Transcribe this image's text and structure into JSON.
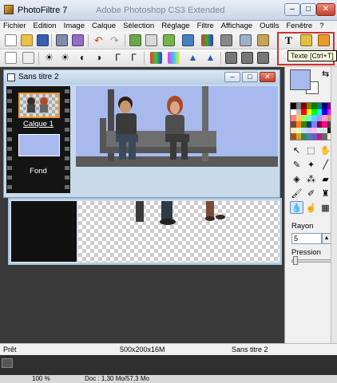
{
  "window": {
    "title": "PhotoFiltre 7",
    "background_title": "Adobe Photoshop CS3 Extended"
  },
  "window_controls": {
    "minimize": "–",
    "maximize": "□",
    "close": "✕"
  },
  "menu": [
    "Fichier",
    "Edition",
    "Image",
    "Calque",
    "Sélection",
    "Réglage",
    "Filtre",
    "Affichage",
    "Outils",
    "Fenêtre",
    "?"
  ],
  "tooltip": {
    "text": "Texte [Ctrl+T]"
  },
  "document": {
    "title": "Sans titre 2",
    "layers": [
      {
        "label": "Calque 1"
      },
      {
        "label": "Fond"
      }
    ]
  },
  "right_panel": {
    "rayon_label": "Rayon",
    "rayon_value": "5",
    "pression_label": "Pression"
  },
  "status": {
    "state": "Prêt",
    "size": "500x200x16M",
    "doc_name": "Sans titre 2"
  },
  "photoshop_status": {
    "zoom": "100 %",
    "doc_info": "Doc : 1,30 Mo/57,3 Mo"
  },
  "colors": {
    "foreground": "#a8b9ee",
    "background": "#ffffff",
    "highlight": "#d0302f",
    "selected_layer_border": "#f29a1f"
  },
  "icons": {
    "toolbar1": [
      "new-icon",
      "open-icon",
      "save-icon",
      "print-icon",
      "scan-icon",
      "undo-icon",
      "redo-icon",
      "copy-icon",
      "paste-icon",
      "image-size-icon",
      "canvas-icon",
      "fit-icon",
      "text-icon",
      "color-swap-icon",
      "crop-icon",
      "filter-icon"
    ],
    "toolbar2": [
      "auto-level-icon",
      "auto-contrast-icon",
      "brightness-minus-icon",
      "brightness-plus-icon",
      "contrast-minus-icon",
      "contrast-plus-icon",
      "gamma-minus-icon",
      "gamma-plus-icon",
      "saturation-icon",
      "hue-icon",
      "blur-icon",
      "sharpen-icon",
      "mirror-icon",
      "flip-icon",
      "rotate-icon"
    ],
    "tools": [
      "pointer-icon",
      "selection-icon",
      "hand-icon",
      "eyedropper-icon",
      "magic-wand-icon",
      "line-icon",
      "fill-icon",
      "spray-icon",
      "eraser-icon",
      "brush-icon",
      "clone-icon",
      "stamp-icon",
      "blur-drop-icon",
      "smudge-icon",
      "pattern-icon"
    ]
  }
}
